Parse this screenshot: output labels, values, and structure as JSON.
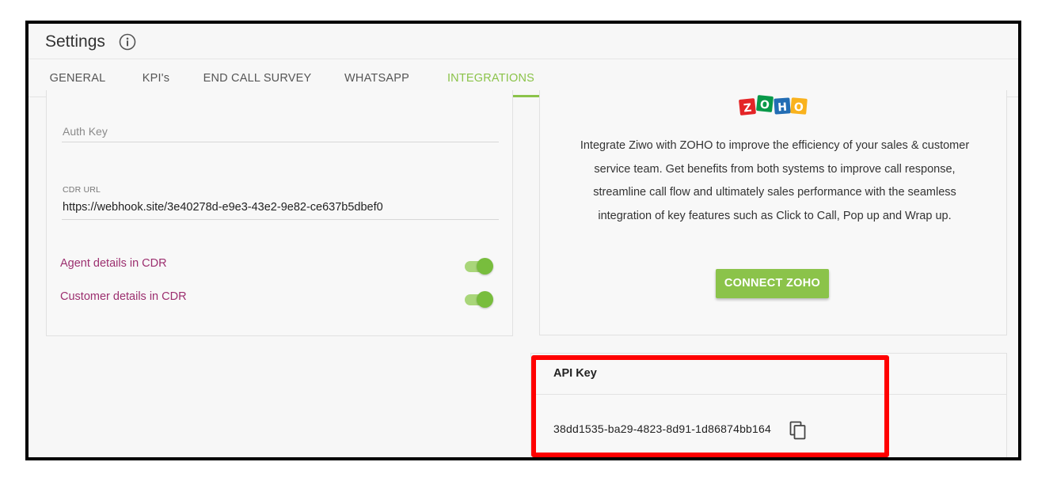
{
  "header": {
    "title": "Settings",
    "info_icon": "info-circle-icon"
  },
  "tabs": [
    {
      "label": "GENERAL",
      "active": false
    },
    {
      "label": "KPI's",
      "active": false
    },
    {
      "label": "END CALL SURVEY",
      "active": false
    },
    {
      "label": "WHATSAPP",
      "active": false
    },
    {
      "label": "INTEGRATIONS",
      "active": true
    }
  ],
  "webhook": {
    "auth_key_placeholder": "Auth Key",
    "cdr_url_label": "CDR URL",
    "cdr_url_value": "https://webhook.site/3e40278d-e9e3-43e2-9e82-ce637b5dbef0",
    "agent_details_label": "Agent details in CDR",
    "agent_details_on": true,
    "customer_details_label": "Customer details in CDR",
    "customer_details_on": true
  },
  "zoho": {
    "logo_text": "ZOHO",
    "description": "Integrate Ziwo with ZOHO to improve the efficiency of your sales & customer service team. Get benefits from both systems to improve call response, streamline call flow and ultimately sales performance with the seamless integration of key features such as Click to Call, Pop up and Wrap up.",
    "connect_label": "CONNECT ZOHO"
  },
  "api": {
    "title": "API Key",
    "key": "38dd1535-ba29-4823-8d91-1d86874bb164",
    "copy_icon": "copy-icon"
  },
  "colors": {
    "accent": "#8bc34a",
    "toggle_label": "#9c2f6f",
    "highlight": "#ff0000"
  }
}
